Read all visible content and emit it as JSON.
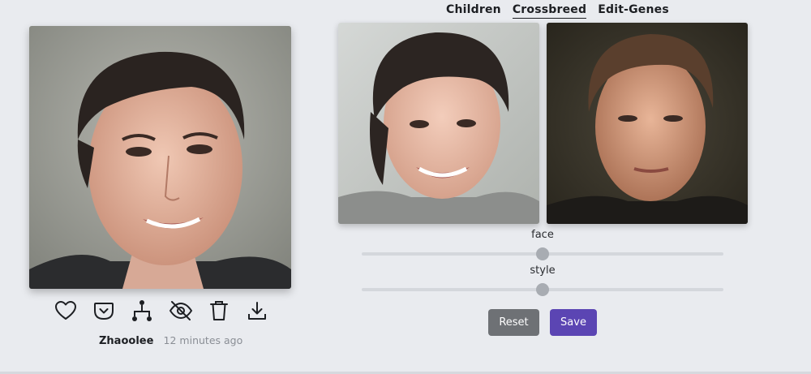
{
  "tabs": [
    {
      "label": "Children",
      "active": false
    },
    {
      "label": "Crossbreed",
      "active": true
    },
    {
      "label": "Edit-Genes",
      "active": false
    }
  ],
  "main_image": {
    "alt": "Generated child portrait"
  },
  "parents": [
    {
      "alt": "Parent one portrait"
    },
    {
      "alt": "Parent two portrait"
    }
  ],
  "actions": [
    {
      "icon": "heart-icon"
    },
    {
      "icon": "pocket-icon"
    },
    {
      "icon": "family-tree-icon"
    },
    {
      "icon": "eye-off-icon"
    },
    {
      "icon": "trash-icon"
    },
    {
      "icon": "download-icon"
    }
  ],
  "meta": {
    "author": "Zhaoolee",
    "time": "12 minutes ago"
  },
  "sliders": {
    "face": {
      "label": "face",
      "value": 0.5
    },
    "style": {
      "label": "style",
      "value": 0.5
    }
  },
  "buttons": {
    "reset": "Reset",
    "save": "Save"
  },
  "colors": {
    "save_button": "#5b45b3",
    "reset_button": "#6e7175",
    "background": "#e9ebef"
  }
}
